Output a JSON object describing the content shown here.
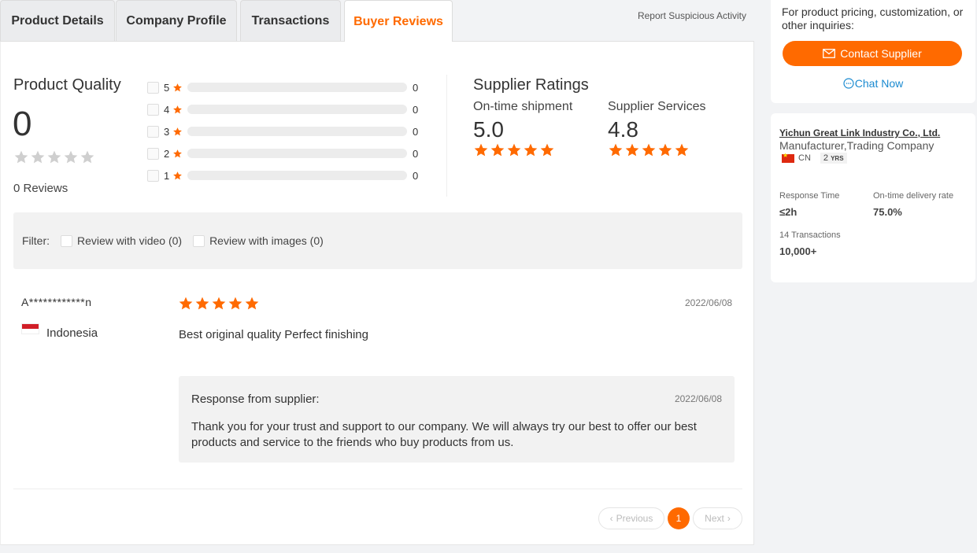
{
  "tabs": [
    "Product Details",
    "Company Profile",
    "Transactions",
    "Buyer Reviews"
  ],
  "report_link": "Report Suspicious Activity",
  "product_quality": {
    "title": "Product Quality",
    "score": "0",
    "reviews": "0 Reviews",
    "rows": [
      {
        "star": "5",
        "count": "0"
      },
      {
        "star": "4",
        "count": "0"
      },
      {
        "star": "3",
        "count": "0"
      },
      {
        "star": "2",
        "count": "0"
      },
      {
        "star": "1",
        "count": "0"
      }
    ]
  },
  "supplier_ratings": {
    "title": "Supplier Ratings",
    "shipment_label": "On-time shipment",
    "shipment_value": "5.0",
    "services_label": "Supplier Services",
    "services_value": "4.8"
  },
  "filter": {
    "label": "Filter:",
    "video": "Review with video (0)",
    "images": "Review with images (0)"
  },
  "review": {
    "name": "A************n",
    "country": "Indonesia",
    "date": "2022/06/08",
    "text": "Best original quality Perfect finishing",
    "stars": 5,
    "response_label": "Response from supplier:",
    "response_date": "2022/06/08",
    "response_text": "Thank you for your trust and support to our company. We will always try our best to offer our best products and service to the friends who buy products from us."
  },
  "pager": {
    "prev": "Previous",
    "current": "1",
    "next": "Next"
  },
  "sidebar": {
    "contact_text": "For product pricing, customization, or other inquiries:",
    "contact_button": "Contact Supplier",
    "chat_now": "Chat Now",
    "company_name": "Yichun Great Link Industry Co., Ltd.",
    "company_type": "Manufacturer,Trading Company",
    "country_code": "CN",
    "years": "2",
    "years_unit": "YRS",
    "response_time_label": "Response Time",
    "response_time_value": "≤2h",
    "delivery_label": "On-time delivery rate",
    "delivery_value": "75.0%",
    "transactions_label": "14 Transactions",
    "transactions_value": "10,000+"
  },
  "colors": {
    "accent": "#ff6a00",
    "link": "#1a8ad0"
  }
}
